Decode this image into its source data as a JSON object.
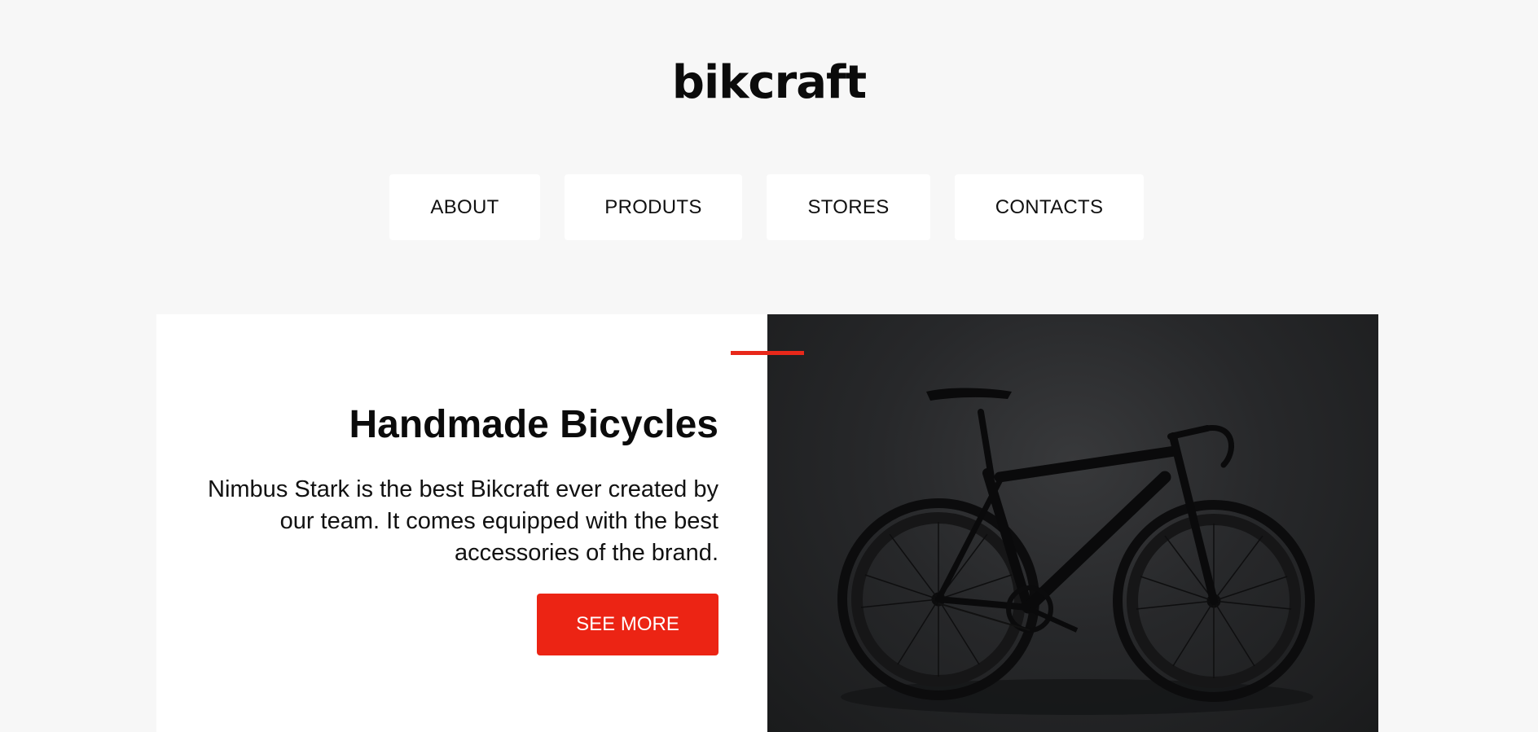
{
  "header": {
    "logo": "bikcraft"
  },
  "nav": {
    "items": [
      {
        "label": "ABOUT"
      },
      {
        "label": "PRODUTS"
      },
      {
        "label": "STORES"
      },
      {
        "label": "CONTACTS"
      }
    ]
  },
  "hero": {
    "title": "Handmade Bicycles",
    "description": "Nimbus Stark is the best Bikcraft ever created by our team. It comes equipped with the best accessories of the brand.",
    "cta_label": "SEE MORE",
    "image_subject": "bicycle-photo"
  },
  "colors": {
    "accent": "#ec2414",
    "background": "#f7f7f7",
    "card": "#ffffff",
    "text": "#0b0b0b"
  }
}
